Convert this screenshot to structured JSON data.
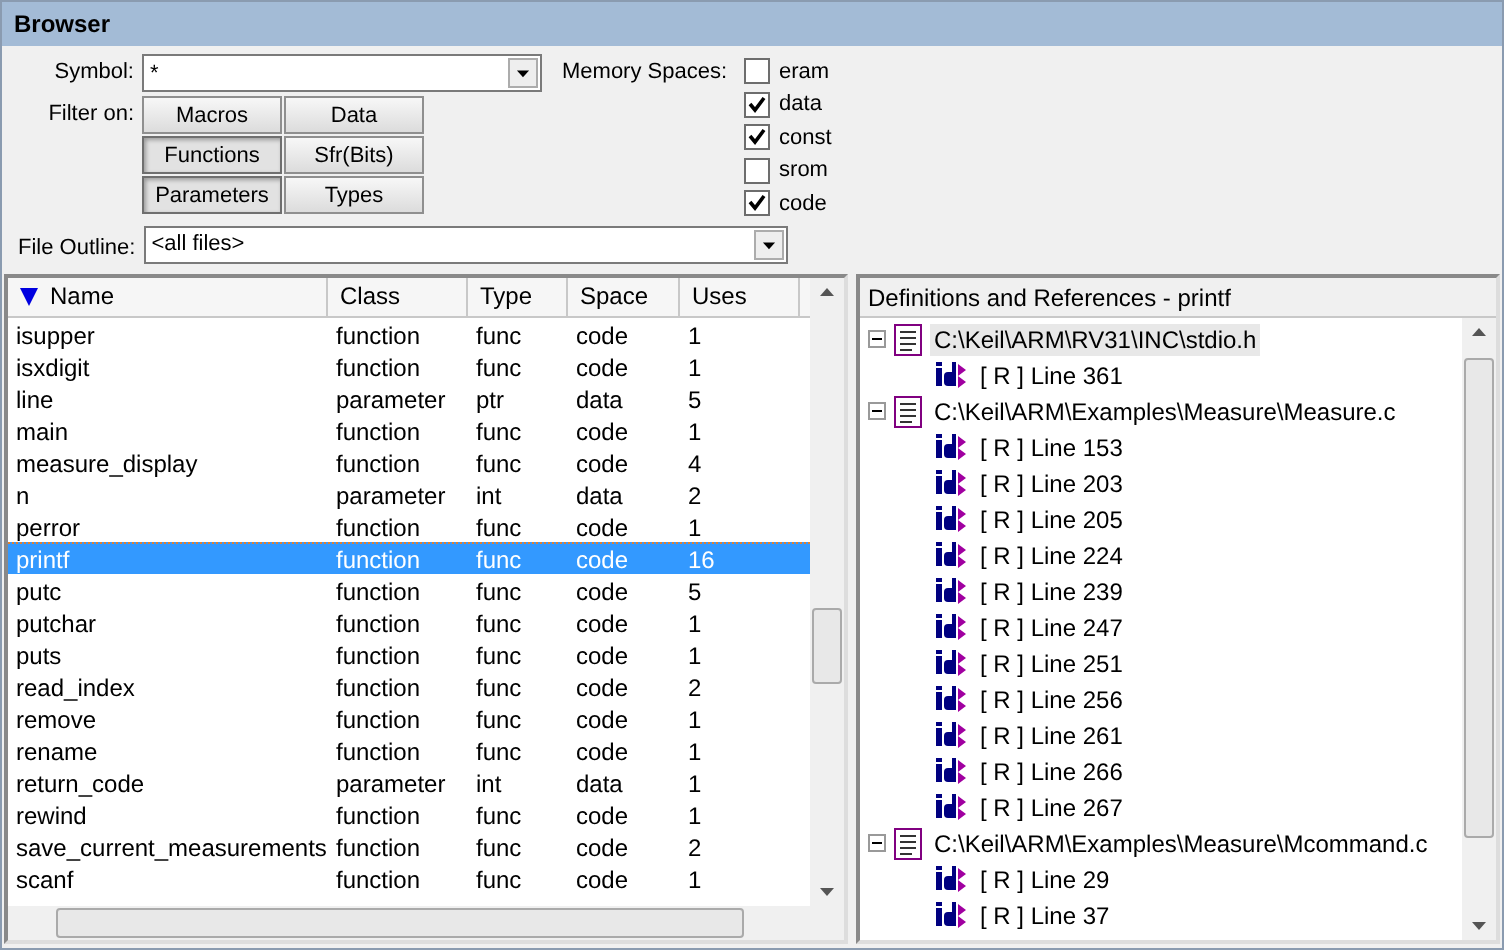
{
  "window": {
    "title": "Browser"
  },
  "symbol": {
    "label": "Symbol:",
    "value": "*"
  },
  "filter": {
    "label": "Filter on:",
    "buttons": [
      {
        "label": "Macros",
        "selected": false
      },
      {
        "label": "Data",
        "selected": false
      },
      {
        "label": "Functions",
        "selected": true
      },
      {
        "label": "Sfr(Bits)",
        "selected": false
      },
      {
        "label": "Parameters",
        "selected": true
      },
      {
        "label": "Types",
        "selected": false
      }
    ]
  },
  "memory_spaces": {
    "label": "Memory Spaces:",
    "items": [
      {
        "label": "eram",
        "checked": false
      },
      {
        "label": "data",
        "checked": true
      },
      {
        "label": "const",
        "checked": true
      },
      {
        "label": "srom",
        "checked": false
      },
      {
        "label": "code",
        "checked": true
      }
    ]
  },
  "file_outline": {
    "label": "File Outline:",
    "value": "<all files>"
  },
  "table": {
    "columns": [
      "Name",
      "Class",
      "Type",
      "Space",
      "Uses"
    ],
    "rows": [
      {
        "cells": [
          "isupper",
          "function",
          "func",
          "code",
          "1"
        ],
        "selected": false
      },
      {
        "cells": [
          "isxdigit",
          "function",
          "func",
          "code",
          "1"
        ],
        "selected": false
      },
      {
        "cells": [
          "line",
          "parameter",
          "ptr",
          "data",
          "5"
        ],
        "selected": false
      },
      {
        "cells": [
          "main",
          "function",
          "func",
          "code",
          "1"
        ],
        "selected": false
      },
      {
        "cells": [
          "measure_display",
          "function",
          "func",
          "code",
          "4"
        ],
        "selected": false
      },
      {
        "cells": [
          "n",
          "parameter",
          "int",
          "data",
          "2"
        ],
        "selected": false
      },
      {
        "cells": [
          "perror",
          "function",
          "func",
          "code",
          "1"
        ],
        "selected": false
      },
      {
        "cells": [
          "printf",
          "function",
          "func",
          "code",
          "16"
        ],
        "selected": true
      },
      {
        "cells": [
          "putc",
          "function",
          "func",
          "code",
          "5"
        ],
        "selected": false
      },
      {
        "cells": [
          "putchar",
          "function",
          "func",
          "code",
          "1"
        ],
        "selected": false
      },
      {
        "cells": [
          "puts",
          "function",
          "func",
          "code",
          "1"
        ],
        "selected": false
      },
      {
        "cells": [
          "read_index",
          "function",
          "func",
          "code",
          "2"
        ],
        "selected": false
      },
      {
        "cells": [
          "remove",
          "function",
          "func",
          "code",
          "1"
        ],
        "selected": false
      },
      {
        "cells": [
          "rename",
          "function",
          "func",
          "code",
          "1"
        ],
        "selected": false
      },
      {
        "cells": [
          "return_code",
          "parameter",
          "int",
          "data",
          "1"
        ],
        "selected": false
      },
      {
        "cells": [
          "rewind",
          "function",
          "func",
          "code",
          "1"
        ],
        "selected": false
      },
      {
        "cells": [
          "save_current_measurements",
          "function",
          "func",
          "code",
          "2"
        ],
        "selected": false
      },
      {
        "cells": [
          "scanf",
          "function",
          "func",
          "code",
          "1"
        ],
        "selected": false
      }
    ]
  },
  "references": {
    "title": "Definitions and References - printf",
    "files": [
      {
        "path": "C:\\Keil\\ARM\\RV31\\INC\\stdio.h",
        "expanded": true,
        "selected": true,
        "children": [
          "[ R ] Line 361"
        ]
      },
      {
        "path": "C:\\Keil\\ARM\\Examples\\Measure\\Measure.c",
        "expanded": true,
        "selected": false,
        "children": [
          "[ R ] Line 153",
          "[ R ] Line 203",
          "[ R ] Line 205",
          "[ R ] Line 224",
          "[ R ] Line 239",
          "[ R ] Line 247",
          "[ R ] Line 251",
          "[ R ] Line 256",
          "[ R ] Line 261",
          "[ R ] Line 266",
          "[ R ] Line 267"
        ]
      },
      {
        "path": "C:\\Keil\\ARM\\Examples\\Measure\\Mcommand.c",
        "expanded": true,
        "selected": false,
        "children": [
          "[ R ] Line 29",
          "[ R ] Line 37"
        ]
      }
    ]
  }
}
